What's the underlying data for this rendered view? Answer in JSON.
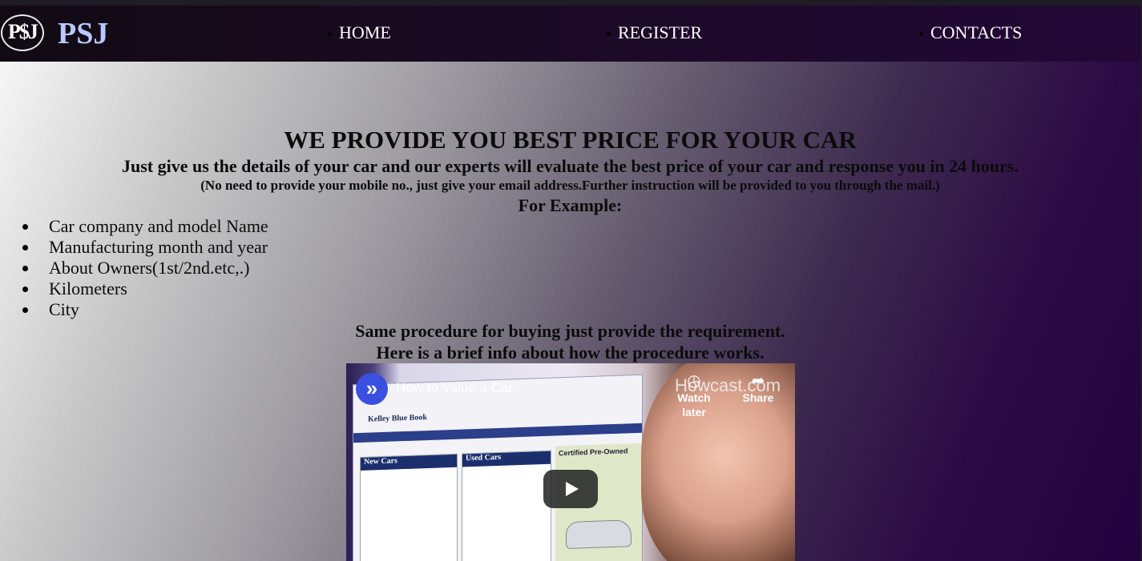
{
  "brand": {
    "logo_text": "P$J",
    "name": "PSJ"
  },
  "nav": {
    "items": [
      {
        "label": "HOME"
      },
      {
        "label": "REGISTER"
      },
      {
        "label": "CONTACTS"
      }
    ]
  },
  "main": {
    "headline": "WE PROVIDE YOU BEST PRICE FOR YOUR CAR",
    "subline": "Just give us the details of your car and our experts will evaluate the best price of your car and response you in 24 hours.",
    "note": "(No need to provide your mobile no., just give your email address.Further instruction will be provided to you through the mail.)",
    "example_heading": "For Example:",
    "example_items": [
      "Car company and model Name",
      "Manufacturing month and year",
      "About Owners(1st/2nd.etc,.)",
      "Kilometers",
      "City"
    ],
    "procedure_1": "Same procedure for buying just provide the requirement.",
    "procedure_2": "Here is a brief info about how the procedure works."
  },
  "video": {
    "title": "How to Value a Car",
    "channel_watermark": "Howcast.com",
    "watch_later_label": "Watch later",
    "share_label": "Share",
    "thumbnail": {
      "site_title": "Kelley Blue Book",
      "col1_header": "New Cars",
      "col2_header": "Used Cars",
      "cpo_header": "Certified Pre-Owned"
    }
  },
  "colors": {
    "navbar_start": "#110a13",
    "navbar_end": "#230838",
    "brand_text": "#b9c8ff",
    "youtube_play_bg": "#212121"
  },
  "icons": {
    "channel": "howcast-channel-icon",
    "watch_later": "clock-icon",
    "share": "share-arrow-icon",
    "play": "play-icon"
  }
}
